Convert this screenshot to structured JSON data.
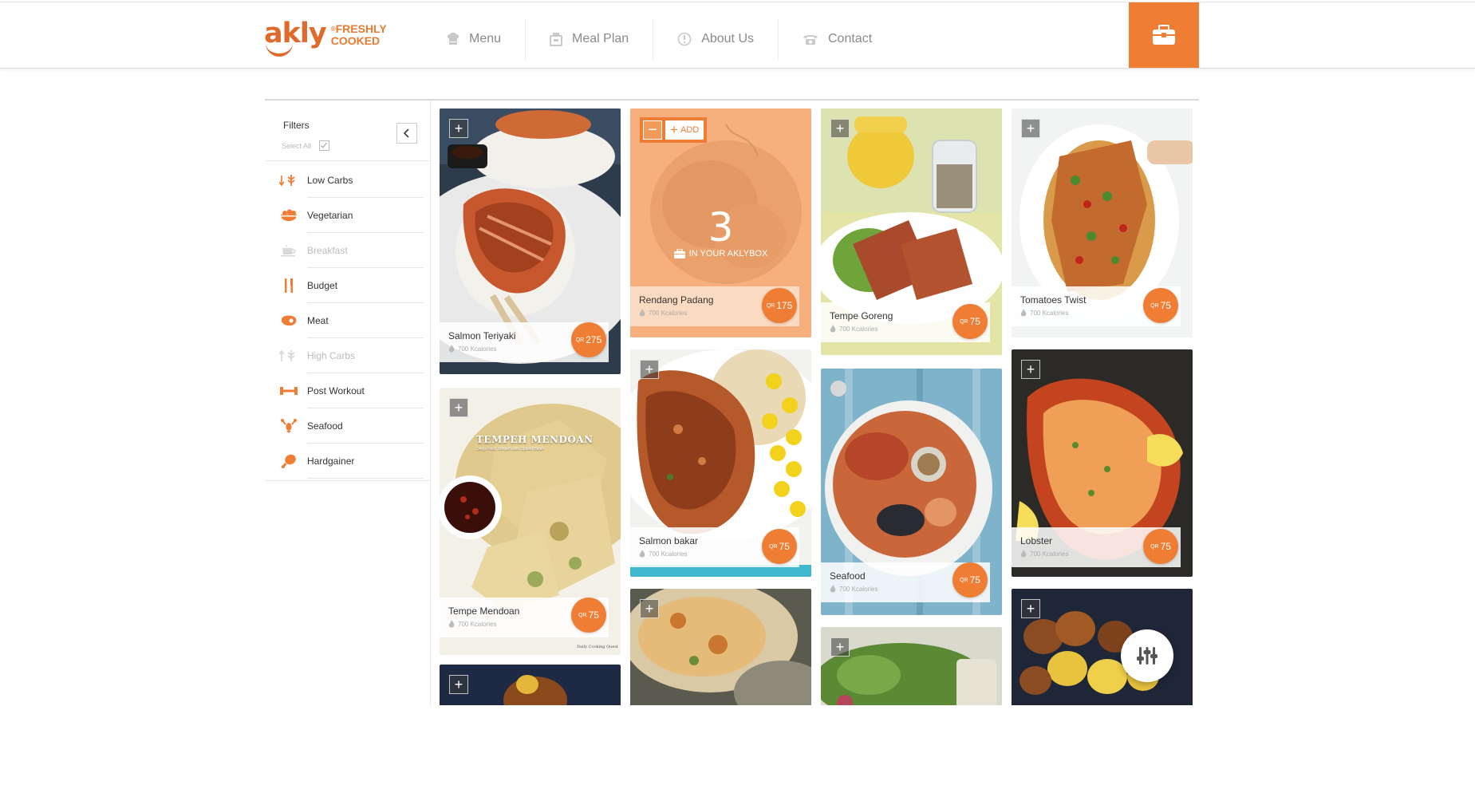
{
  "brand": {
    "name": "akly",
    "registered": "®",
    "tagline_line1": "FRESHLY",
    "tagline_line2": "COOKED"
  },
  "nav": [
    {
      "label": "Menu",
      "icon": "chef-hat-icon"
    },
    {
      "label": "Meal Plan",
      "icon": "meal-box-icon"
    },
    {
      "label": "About Us",
      "icon": "info-icon"
    },
    {
      "label": "Contact",
      "icon": "telephone-icon"
    }
  ],
  "header": {
    "box_button_icon": "lunchbox-icon"
  },
  "sidebar": {
    "title": "Filters",
    "select_all": "Select All",
    "collapse_icon": "chevron-left-icon",
    "items": [
      {
        "label": "Low Carbs",
        "icon": "low-carbs-icon",
        "active": true
      },
      {
        "label": "Vegetarian",
        "icon": "salad-bowl-icon",
        "active": true
      },
      {
        "label": "Breakfast",
        "icon": "coffee-cup-icon",
        "active": false
      },
      {
        "label": "Budget",
        "icon": "fork-knife-icon",
        "active": true
      },
      {
        "label": "Meat",
        "icon": "steak-icon",
        "active": true
      },
      {
        "label": "High Carbs",
        "icon": "high-carbs-icon",
        "active": false
      },
      {
        "label": "Post Workout",
        "icon": "dumbbell-icon",
        "active": true
      },
      {
        "label": "Seafood",
        "icon": "lobster-icon",
        "active": true
      },
      {
        "label": "Hardgainer",
        "icon": "drumstick-icon",
        "active": true
      }
    ]
  },
  "meals": [
    {
      "name": "Salmon Teriyaki",
      "calories": "700 Kcalories",
      "currency": "QR",
      "price": "275"
    },
    {
      "name": "Tempe Mendoan",
      "calories": "700 Kcalories",
      "currency": "QR",
      "price": "75",
      "photo_text": "TEMPEH MENDOAN",
      "photo_subtext": "Deep Fried Tempeh with Spiced Batter",
      "photo_credit": "Daily Cooking Quest"
    },
    {
      "name": "Rendang Padang",
      "calories": "700 Kcalories",
      "currency": "QR",
      "price": "175",
      "selected": true,
      "quantity": "3",
      "in_box_label": "IN YOUR AKLYBOX",
      "add_label": "ADD"
    },
    {
      "name": "Salmon bakar",
      "calories": "700 Kcalories",
      "currency": "QR",
      "price": "75"
    },
    {
      "name": "Tempe Goreng",
      "calories": "700 Kcalories",
      "currency": "QR",
      "price": "75"
    },
    {
      "name": "Seafood",
      "calories": "700 Kcalories",
      "currency": "QR",
      "price": "75"
    },
    {
      "name": "Tomatoes Twist",
      "calories": "700 Kcalories",
      "currency": "QR",
      "price": "75"
    },
    {
      "name": "Lobster",
      "calories": "700 Kcalories",
      "currency": "QR",
      "price": "75"
    }
  ],
  "fab": {
    "icon": "filter-sliders-icon"
  },
  "colors": {
    "accent": "#ef7d33",
    "brand": "#e06a2c"
  }
}
